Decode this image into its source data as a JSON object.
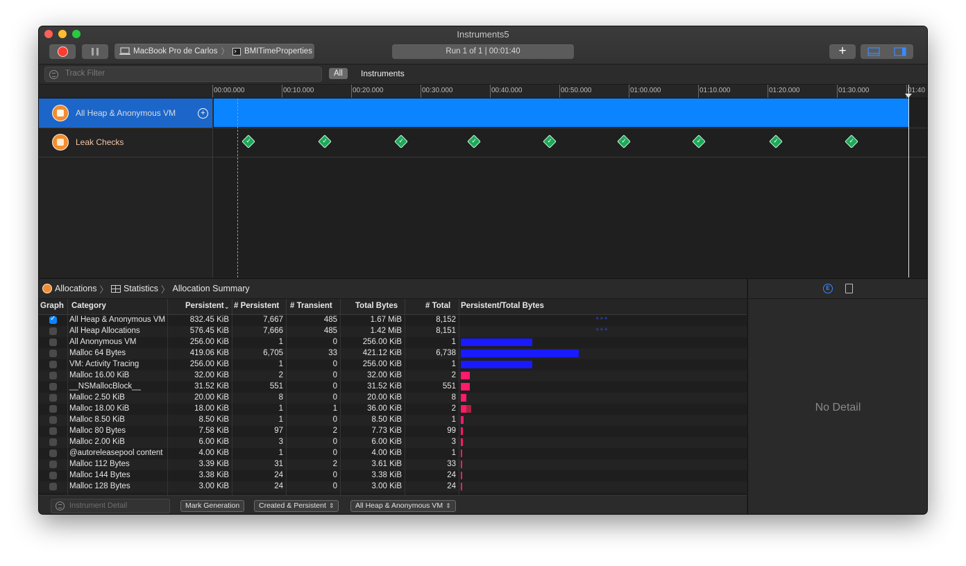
{
  "window": {
    "title": "Instruments5"
  },
  "toolbar": {
    "device": "MacBook Pro de Carlos",
    "target": "BMITimeProperties",
    "run_label": "Run 1 of 1  |  00:01:40",
    "add_label": "+"
  },
  "filterbar": {
    "placeholder": "Track Filter",
    "scope_all": "All",
    "scope_instruments": "Instruments"
  },
  "ruler": {
    "ticks": [
      "00:00.000",
      "00:10.000",
      "00:20.000",
      "00:30.000",
      "00:40.000",
      "00:50.000",
      "01:00.000",
      "01:10.000",
      "01:20.000",
      "01:30.000",
      "01:40"
    ]
  },
  "tracks": [
    {
      "name": "All Heap & Anonymous VM"
    },
    {
      "name": "Leak Checks"
    }
  ],
  "breadcrumb": {
    "item1": "Allocations",
    "item2": "Statistics",
    "item3": "Allocation Summary"
  },
  "table": {
    "headers": {
      "graph": "Graph",
      "category": "Category",
      "persistent": "Persistent",
      "n_persistent": "# Persistent",
      "n_transient": "# Transient",
      "total_bytes": "Total Bytes",
      "n_total": "# Total",
      "ratio": "Persistent/Total Bytes"
    },
    "rows": [
      {
        "checked": true,
        "category": "All Heap & Anonymous VM",
        "persistent": "832.45 KiB",
        "n_persistent": "7,667",
        "n_transient": "485",
        "total_bytes": "1.67 MiB",
        "n_total": "8,152",
        "stars": "+++"
      },
      {
        "checked": false,
        "category": "All Heap Allocations",
        "persistent": "576.45 KiB",
        "n_persistent": "7,666",
        "n_transient": "485",
        "total_bytes": "1.42 MiB",
        "n_total": "8,151",
        "stars": "+++"
      },
      {
        "checked": false,
        "category": "All Anonymous VM",
        "persistent": "256.00 KiB",
        "n_persistent": "1",
        "n_transient": "0",
        "total_bytes": "256.00 KiB",
        "n_total": "1"
      },
      {
        "checked": false,
        "category": "Malloc 64 Bytes",
        "persistent": "419.06 KiB",
        "n_persistent": "6,705",
        "n_transient": "33",
        "total_bytes": "421.12 KiB",
        "n_total": "6,738"
      },
      {
        "checked": false,
        "category": "VM: Activity Tracing",
        "persistent": "256.00 KiB",
        "n_persistent": "1",
        "n_transient": "0",
        "total_bytes": "256.00 KiB",
        "n_total": "1"
      },
      {
        "checked": false,
        "category": "Malloc 16.00 KiB",
        "persistent": "32.00 KiB",
        "n_persistent": "2",
        "n_transient": "0",
        "total_bytes": "32.00 KiB",
        "n_total": "2"
      },
      {
        "checked": false,
        "category": "__NSMallocBlock__",
        "persistent": "31.52 KiB",
        "n_persistent": "551",
        "n_transient": "0",
        "total_bytes": "31.52 KiB",
        "n_total": "551"
      },
      {
        "checked": false,
        "category": "Malloc 2.50 KiB",
        "persistent": "20.00 KiB",
        "n_persistent": "8",
        "n_transient": "0",
        "total_bytes": "20.00 KiB",
        "n_total": "8"
      },
      {
        "checked": false,
        "category": "Malloc 18.00 KiB",
        "persistent": "18.00 KiB",
        "n_persistent": "1",
        "n_transient": "1",
        "total_bytes": "36.00 KiB",
        "n_total": "2"
      },
      {
        "checked": false,
        "category": "Malloc 8.50 KiB",
        "persistent": "8.50 KiB",
        "n_persistent": "1",
        "n_transient": "0",
        "total_bytes": "8.50 KiB",
        "n_total": "1"
      },
      {
        "checked": false,
        "category": "Malloc 80 Bytes",
        "persistent": "7.58 KiB",
        "n_persistent": "97",
        "n_transient": "2",
        "total_bytes": "7.73 KiB",
        "n_total": "99"
      },
      {
        "checked": false,
        "category": "Malloc 2.00 KiB",
        "persistent": "6.00 KiB",
        "n_persistent": "3",
        "n_transient": "0",
        "total_bytes": "6.00 KiB",
        "n_total": "3"
      },
      {
        "checked": false,
        "category": "@autoreleasepool content",
        "persistent": "4.00 KiB",
        "n_persistent": "1",
        "n_transient": "0",
        "total_bytes": "4.00 KiB",
        "n_total": "1"
      },
      {
        "checked": false,
        "category": "Malloc 112 Bytes",
        "persistent": "3.39 KiB",
        "n_persistent": "31",
        "n_transient": "2",
        "total_bytes": "3.61 KiB",
        "n_total": "33"
      },
      {
        "checked": false,
        "category": "Malloc 144 Bytes",
        "persistent": "3.38 KiB",
        "n_persistent": "24",
        "n_transient": "0",
        "total_bytes": "3.38 KiB",
        "n_total": "24"
      },
      {
        "checked": false,
        "category": "Malloc 128 Bytes",
        "persistent": "3.00 KiB",
        "n_persistent": "24",
        "n_transient": "0",
        "total_bytes": "3.00 KiB",
        "n_total": "24"
      }
    ]
  },
  "footer": {
    "detail_placeholder": "Instrument Detail",
    "mark_generation": "Mark Generation",
    "lifespan": "Created & Persistent",
    "scope": "All Heap & Anonymous VM"
  },
  "detail": {
    "empty_label": "No Detail"
  },
  "colors": {
    "selection": "#1c66c9",
    "track_fill": "#0a84ff",
    "bar_vm": "#1a1aff",
    "bar_heap": "#ff1a6b",
    "bar_transient": "#a3263f",
    "check_green": "#1fa85a"
  }
}
